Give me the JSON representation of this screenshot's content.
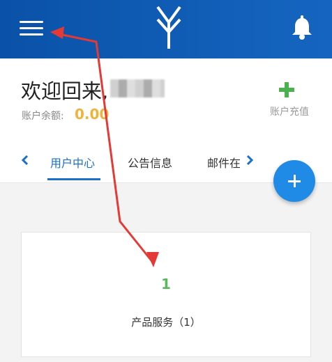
{
  "header": {
    "menu_icon": "hamburger-menu-icon",
    "logo_icon": "brand-y-logo-icon",
    "bell_icon": "bell-icon",
    "background": "#0a52a8"
  },
  "welcome": {
    "greeting": "欢迎回来,",
    "balance_label": "账户余额:",
    "balance_value": "0.00",
    "balance_color": "#f0b33a",
    "recharge_label": "账户充值",
    "recharge_icon": "plus-icon"
  },
  "tabs": {
    "items": [
      {
        "label": "用户中心",
        "active": true
      },
      {
        "label": "公告信息",
        "active": false
      },
      {
        "label": "邮件在",
        "active": false
      }
    ],
    "left_icon": "chevron-left-icon",
    "right_icon": "chevron-right-icon",
    "accent": "#1a6fc9"
  },
  "fab": {
    "icon": "plus-icon"
  },
  "card": {
    "count": "1",
    "service_label": "产品服务（1）"
  },
  "annotation": {
    "arrow_color": "#e53935"
  }
}
